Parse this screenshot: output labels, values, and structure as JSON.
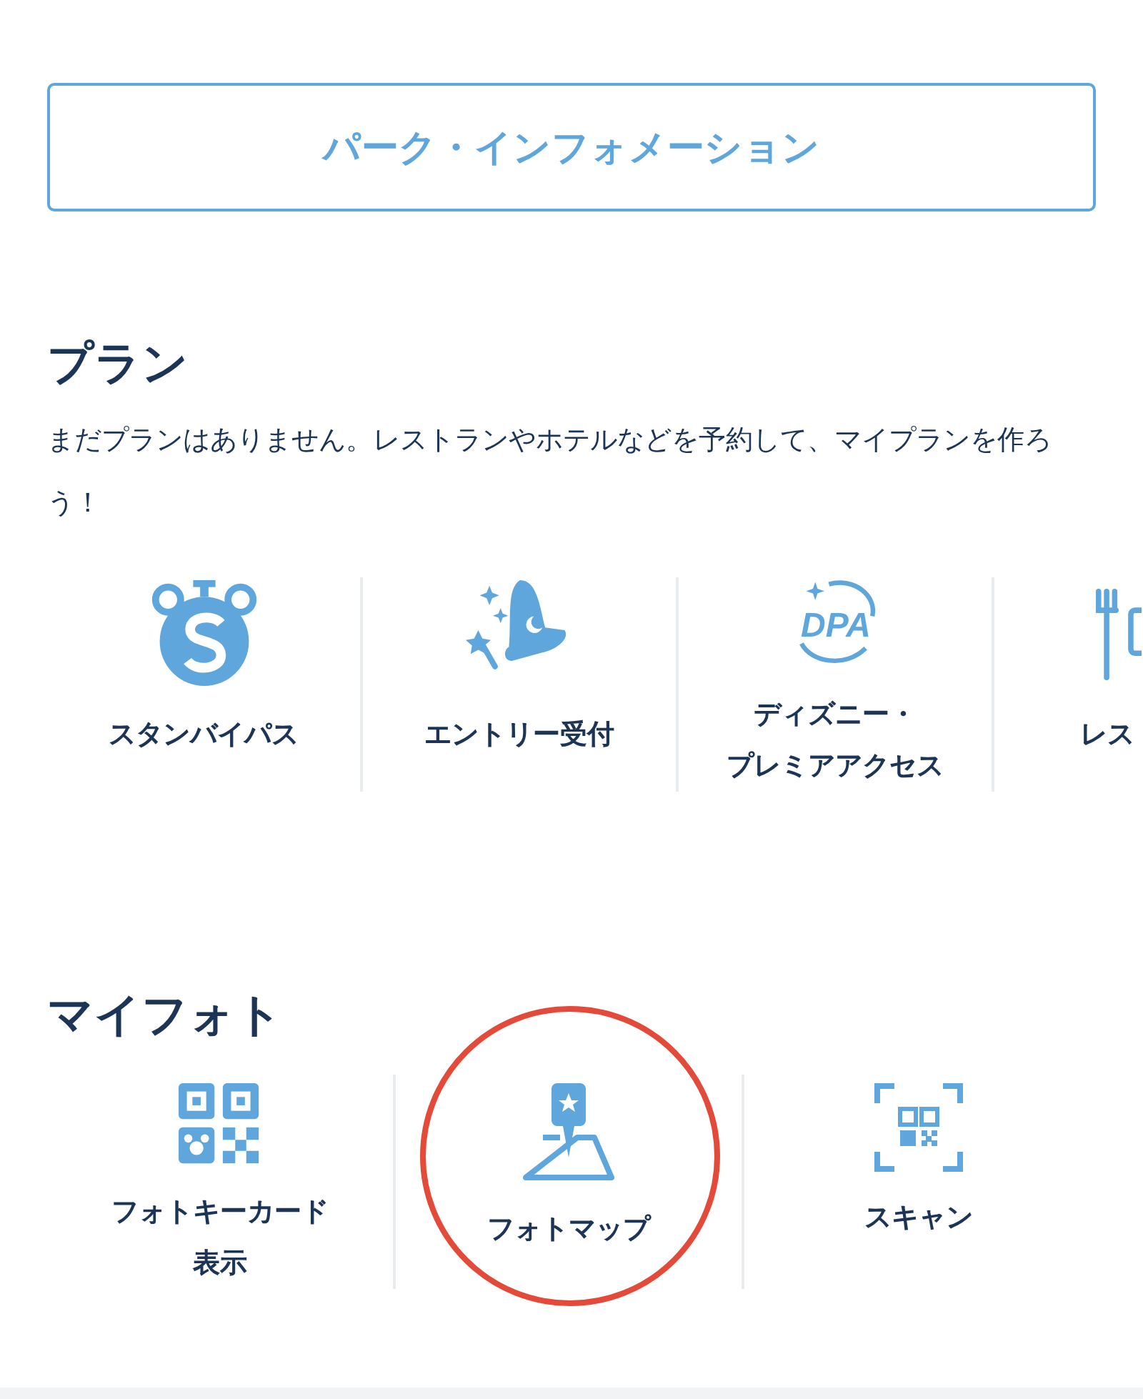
{
  "info_button": {
    "label": "パーク・インフォメーション"
  },
  "plan": {
    "title": "プラン",
    "message": "まだプランはありません。レストランやホテルなどを予約して、マイプランを作ろう！",
    "items": [
      {
        "kind": "standby",
        "lines": [
          "スタンバイパス"
        ]
      },
      {
        "kind": "entry",
        "lines": [
          "エントリー受付"
        ]
      },
      {
        "kind": "dpa",
        "logo": "DPA",
        "lines": [
          "ディズニー・",
          "プレミアアクセス"
        ]
      },
      {
        "kind": "restaurant",
        "lines": [
          "レス"
        ]
      }
    ]
  },
  "photo": {
    "title": "マイフォト",
    "items": [
      {
        "kind": "qr",
        "lines": [
          "フォトキーカード",
          "表示"
        ],
        "highlighted": false
      },
      {
        "kind": "map",
        "lines": [
          "フォトマップ"
        ],
        "highlighted": true
      },
      {
        "kind": "scan",
        "lines": [
          "スキャン"
        ],
        "highlighted": false
      }
    ]
  }
}
